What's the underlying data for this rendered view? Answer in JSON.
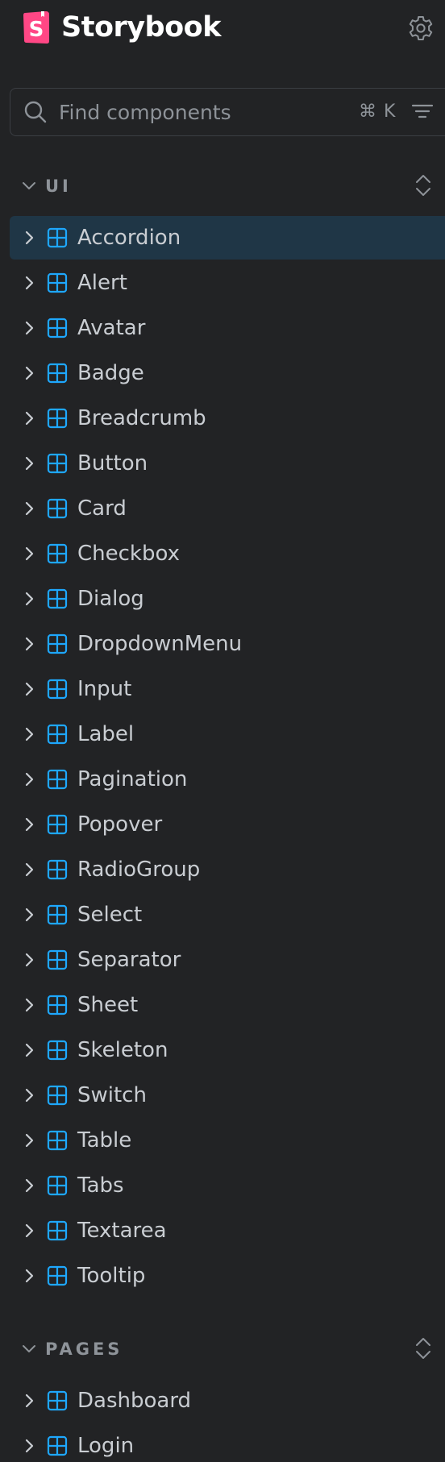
{
  "app": {
    "brand_name": "Storybook",
    "logo_letter": "S"
  },
  "search": {
    "placeholder": "Find components",
    "shortcut": "⌘ K"
  },
  "colors": {
    "background": "#222325",
    "brand": "#ff4785",
    "component_icon": "#1ea7fd",
    "selected_background": "#1f3646",
    "text": "#c9cdd2",
    "muted_text": "#8e9399"
  },
  "icons": {
    "settings": "gear-icon",
    "search": "search-icon",
    "filter": "filter-icon",
    "expand": "chevron-right-icon",
    "section_toggle": "chevron-down-icon",
    "collapse_all": "expand-collapse-icon",
    "component": "component-icon"
  },
  "sections": [
    {
      "title": "UI",
      "items": [
        {
          "label": "Accordion",
          "selected": true
        },
        {
          "label": "Alert"
        },
        {
          "label": "Avatar"
        },
        {
          "label": "Badge"
        },
        {
          "label": "Breadcrumb"
        },
        {
          "label": "Button"
        },
        {
          "label": "Card"
        },
        {
          "label": "Checkbox"
        },
        {
          "label": "Dialog"
        },
        {
          "label": "DropdownMenu"
        },
        {
          "label": "Input"
        },
        {
          "label": "Label"
        },
        {
          "label": "Pagination"
        },
        {
          "label": "Popover"
        },
        {
          "label": "RadioGroup"
        },
        {
          "label": "Select"
        },
        {
          "label": "Separator"
        },
        {
          "label": "Sheet"
        },
        {
          "label": "Skeleton"
        },
        {
          "label": "Switch"
        },
        {
          "label": "Table"
        },
        {
          "label": "Tabs"
        },
        {
          "label": "Textarea"
        },
        {
          "label": "Tooltip"
        }
      ]
    },
    {
      "title": "PAGES",
      "items": [
        {
          "label": "Dashboard"
        },
        {
          "label": "Login"
        }
      ]
    }
  ]
}
